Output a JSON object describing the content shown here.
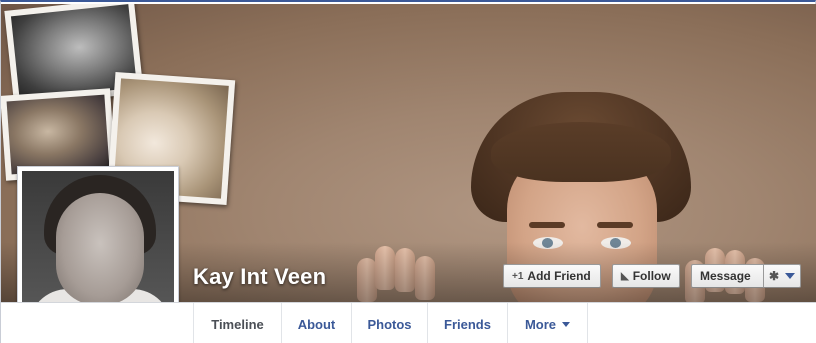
{
  "profile": {
    "name": "Kay Int Veen"
  },
  "actions": {
    "add_friend": {
      "label": "Add Friend",
      "icon": "add-friend-icon"
    },
    "follow": {
      "label": "Follow",
      "icon": "rss-icon"
    },
    "message": {
      "label": "Message"
    },
    "settings": {
      "icon": "gear-icon"
    }
  },
  "tabs": [
    {
      "label": "Timeline",
      "active": true
    },
    {
      "label": "About"
    },
    {
      "label": "Photos"
    },
    {
      "label": "Friends"
    },
    {
      "label": "More"
    }
  ],
  "colors": {
    "brand": "#3b5998",
    "cover_tone": "#a08570"
  }
}
